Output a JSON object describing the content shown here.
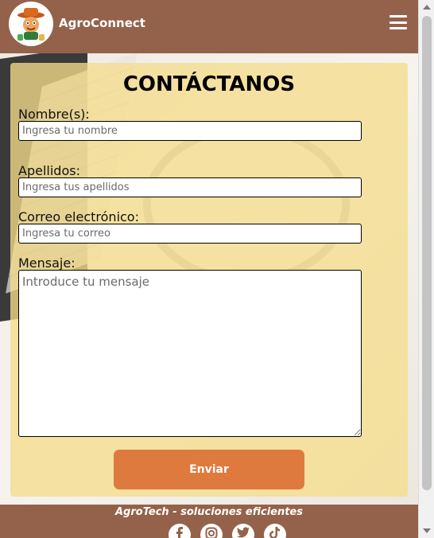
{
  "header": {
    "brand": "AgroConnect",
    "logo_icon": "farmer-mascot-icon",
    "menu_icon": "hamburger-menu-icon"
  },
  "form": {
    "title": "CONTÁCTANOS",
    "nombre": {
      "label": "Nombre(s):",
      "placeholder": "Ingresa tu nombre",
      "value": ""
    },
    "apellidos": {
      "label": "Apellidos:",
      "placeholder": "Ingresa tus apellidos",
      "value": ""
    },
    "correo": {
      "label": "Correo electrónico:",
      "placeholder": "Ingresa tu correo",
      "value": ""
    },
    "mensaje": {
      "label": "Mensaje:",
      "placeholder": "Introduce tu mensaje",
      "value": ""
    },
    "submit_label": "Enviar"
  },
  "footer": {
    "tagline": "AgroTech - soluciones eficientes",
    "socials": [
      "facebook-icon",
      "instagram-icon",
      "twitter-icon",
      "tiktok-icon"
    ]
  },
  "colors": {
    "header_bg": "#94624a",
    "card_bg": "#f5dc8c",
    "button_bg": "#df7a3f"
  }
}
